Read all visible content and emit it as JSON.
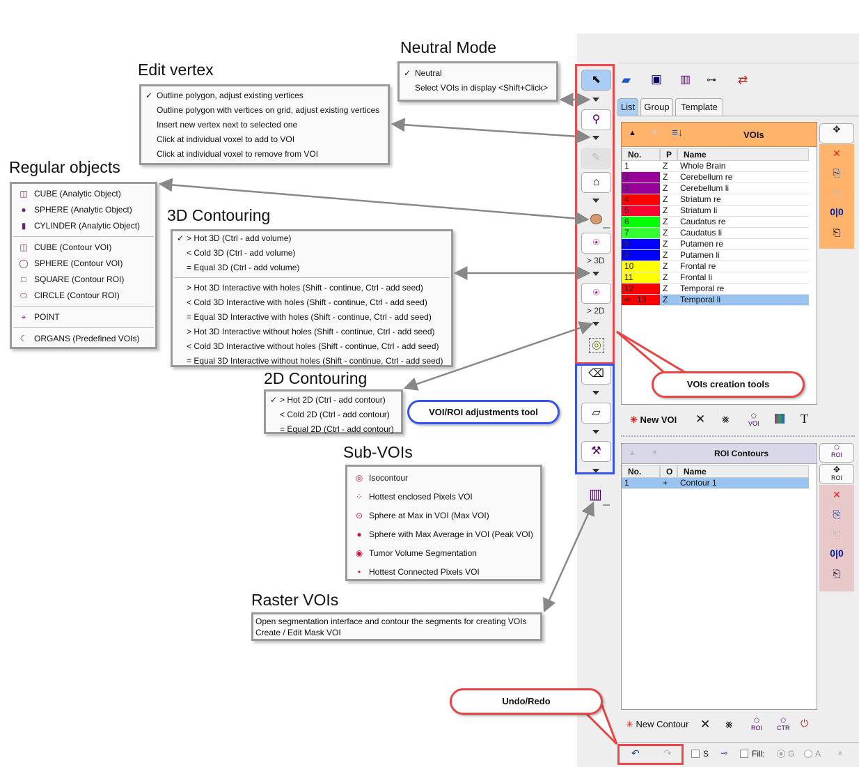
{
  "titles": {
    "neutral": "Neutral Mode",
    "edit_vertex": "Edit vertex",
    "regular": "Regular objects",
    "contour3d": "3D Contouring",
    "contour2d": "2D Contouring",
    "subvois": "Sub-VOIs",
    "raster": "Raster VOIs"
  },
  "menus": {
    "neutral": [
      {
        "check": "✓",
        "label": "Neutral"
      },
      {
        "check": "",
        "label": "Select VOIs in display <Shift+Click>"
      }
    ],
    "edit_vertex": [
      {
        "check": "✓",
        "label": "Outline polygon, adjust existing vertices"
      },
      {
        "check": "",
        "label": "Outline polygon with vertices on grid, adjust existing vertices"
      },
      {
        "check": "",
        "label": "Insert new vertex next to selected one"
      },
      {
        "check": "",
        "label": "Click at individual voxel to add to VOI"
      },
      {
        "check": "",
        "label": "Click at individual voxel to remove from VOI"
      }
    ],
    "regular": [
      {
        "icon": "cube-icon",
        "glyph": "◫",
        "label": "CUBE (Analytic Object)"
      },
      {
        "icon": "sphere-icon",
        "glyph": "●",
        "label": "SPHERE (Analytic Object)"
      },
      {
        "icon": "cylinder-icon",
        "glyph": "▮",
        "label": "CYLINDER (Analytic Object)"
      },
      {
        "sep": true
      },
      {
        "icon": "cube-icon",
        "glyph": "◫",
        "label": "CUBE (Contour VOI)"
      },
      {
        "icon": "sphere-icon",
        "glyph": "◯",
        "label": "SPHERE (Contour VOI)"
      },
      {
        "icon": "square-icon",
        "glyph": "□",
        "label": "SQUARE (Contour ROI)"
      },
      {
        "icon": "circle-icon",
        "glyph": "⬭",
        "label": "CIRCLE (Contour ROI)"
      },
      {
        "sep": true
      },
      {
        "icon": "point-icon",
        "glyph": "⌖",
        "label": "POINT"
      },
      {
        "sep": true
      },
      {
        "icon": "organs-icon",
        "glyph": "☾",
        "label": "ORGANS (Predefined VOIs)"
      }
    ],
    "contour3d": [
      {
        "check": "✓",
        "label": "> Hot 3D (Ctrl - add volume)"
      },
      {
        "check": "",
        "label": "< Cold 3D (Ctrl - add volume)"
      },
      {
        "check": "",
        "label": "= Equal 3D (Ctrl - add volume)"
      },
      {
        "sep": true
      },
      {
        "check": "",
        "label": "> Hot 3D Interactive with holes (Shift - continue, Ctrl - add seed)"
      },
      {
        "check": "",
        "label": "< Cold 3D Interactive with holes (Shift - continue, Ctrl - add seed)"
      },
      {
        "check": "",
        "label": "= Equal 3D Interactive with holes (Shift - continue, Ctrl - add seed)"
      },
      {
        "check": "",
        "label": "> Hot 3D Interactive without holes (Shift - continue, Ctrl - add seed)"
      },
      {
        "check": "",
        "label": "< Cold 3D Interactive without holes (Shift - continue, Ctrl - add seed)"
      },
      {
        "check": "",
        "label": "= Equal 3D Interactive without holes (Shift - continue, Ctrl - add seed)"
      }
    ],
    "contour2d": [
      {
        "check": "✓",
        "label": "> Hot 2D (Ctrl - add contour)"
      },
      {
        "check": "",
        "label": "< Cold 2D (Ctrl - add contour)"
      },
      {
        "check": "",
        "label": "= Equal 2D (Ctrl - add contour)"
      }
    ],
    "subvois": [
      {
        "icon": "isocontour-icon",
        "glyph": "◎",
        "label": "Isocontour"
      },
      {
        "icon": "hottest-pixels-icon",
        "glyph": "⁘",
        "label": "Hottest enclosed Pixels VOI"
      },
      {
        "icon": "max-voi-icon",
        "glyph": "⊙",
        "label": "Sphere at Max in VOI (Max VOI)"
      },
      {
        "icon": "peak-voi-icon",
        "glyph": "●",
        "label": "Sphere with Max Average in VOI (Peak VOI)"
      },
      {
        "icon": "tumor-segmentation-icon",
        "glyph": "◉",
        "label": "Tumor Volume Segmentation"
      },
      {
        "icon": "hottest-connected-icon",
        "glyph": "•",
        "label": "Hottest Connected Pixels VOI"
      }
    ],
    "raster": [
      {
        "check": "",
        "label": "Open segmentation interface and contour the segments for creating VOIs"
      },
      {
        "check": "",
        "label": "Create / Edit Mask VOI"
      }
    ]
  },
  "toolbar": {
    "label_3d": "> 3D",
    "label_2d": "> 2D"
  },
  "tabs": [
    "List",
    "Group",
    "Template"
  ],
  "vois": {
    "title": "VOIs",
    "columns": [
      "No.",
      "P",
      "Name"
    ],
    "rows": [
      {
        "no": "1",
        "p": "Z",
        "name": "Whole Brain",
        "color": "#ffffff"
      },
      {
        "no": "2",
        "p": "Z",
        "name": "Cerebellum re",
        "color": "#990099"
      },
      {
        "no": "3",
        "p": "Z",
        "name": "Cerebellum li",
        "color": "#990099"
      },
      {
        "no": "4",
        "p": "Z",
        "name": "Striatum re",
        "color": "#ff0000"
      },
      {
        "no": "5",
        "p": "Z",
        "name": "Striatum li",
        "color": "#ff0033"
      },
      {
        "no": "6",
        "p": "Z",
        "name": "Caudatus re",
        "color": "#00ff00"
      },
      {
        "no": "7",
        "p": "Z",
        "name": "Caudatus li",
        "color": "#33ff33"
      },
      {
        "no": "8",
        "p": "Z",
        "name": "Putamen re",
        "color": "#0000ff"
      },
      {
        "no": "9",
        "p": "Z",
        "name": "Putamen li",
        "color": "#0000ff"
      },
      {
        "no": "10",
        "p": "Z",
        "name": "Frontal re",
        "color": "#ffff00"
      },
      {
        "no": "11",
        "p": "Z",
        "name": "Frontal li",
        "color": "#ffff00"
      },
      {
        "no": "12",
        "p": "Z",
        "name": "Temporal re",
        "color": "#ff0000"
      },
      {
        "no": "13",
        "p": "Z",
        "name": "Temporal li",
        "color": "#ff0000",
        "selected": true
      }
    ],
    "new_label": "New VOI"
  },
  "rois": {
    "title": "ROI Contours",
    "columns": [
      "No.",
      "O",
      "Name"
    ],
    "rows": [
      {
        "no": "1",
        "o": "+",
        "name": "Contour 1"
      }
    ],
    "new_label": "New Contour",
    "roi_label": "ROI",
    "ctr_label": "CTR",
    "voi_label": "VOI"
  },
  "bottom": {
    "s_label": "S",
    "fill_label": "Fill:",
    "g_label": "G",
    "a_label": "A"
  },
  "callouts": {
    "vois_creation": "VOIs creation tools",
    "adjust": "VOI/ROI adjustments tool",
    "undo": "Undo/Redo"
  },
  "colors": {
    "orange": "#ffb36b",
    "lavender": "#d8d8e8",
    "pink": "#e8c8c8",
    "red_box": "#f04848",
    "blue_box": "#3355ee",
    "selected": "#99c4f0"
  }
}
